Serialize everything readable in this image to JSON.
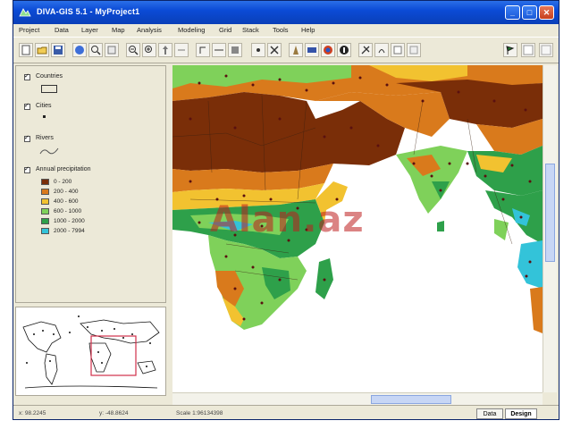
{
  "window": {
    "title": "DIVA-GIS 5.1 - MyProject1"
  },
  "menu": [
    "Project",
    "Data",
    "Layer",
    "Map",
    "Analysis",
    "Modeling",
    "Grid",
    "Stack",
    "Tools",
    "Help"
  ],
  "toolbar": {
    "icons": [
      "new-icon",
      "open-icon",
      "save-icon",
      "full-extent-icon",
      "zoom-layer-icon",
      "zoom-in-icon",
      "zoom-out-icon",
      "zoom-previous-icon",
      "pan-icon",
      "select-icon",
      "measure-icon",
      "identify-icon",
      "add-point-icon",
      "remove-icon",
      "query-icon",
      "table-icon",
      "globe-icon",
      "info-icon",
      "tools-icon",
      "rectangle-icon",
      "overlay-icon",
      "graph-icon",
      "flag-icon",
      "export-icon",
      "grid-icon"
    ]
  },
  "legend": {
    "themes": [
      {
        "label": "Countries"
      },
      {
        "label": "Cities"
      },
      {
        "label": "Rivers"
      },
      {
        "label": "Annual precipitation"
      }
    ],
    "classes": [
      {
        "label": "0 - 200",
        "color": "#7a2e08"
      },
      {
        "label": "200 - 400",
        "color": "#d97a1c"
      },
      {
        "label": "400 - 600",
        "color": "#f2c230"
      },
      {
        "label": "600 - 1000",
        "color": "#7fd15a"
      },
      {
        "label": "1000 - 2000",
        "color": "#2ea04a"
      },
      {
        "label": "2000 - 7994",
        "color": "#33c3d9"
      }
    ]
  },
  "status": {
    "x": "x: 98.2245",
    "y": "y: -48.8624",
    "scale": "Scale 1:96134398"
  },
  "tabs": {
    "data": "Data",
    "design": "Design"
  },
  "watermark": "Alan.az"
}
